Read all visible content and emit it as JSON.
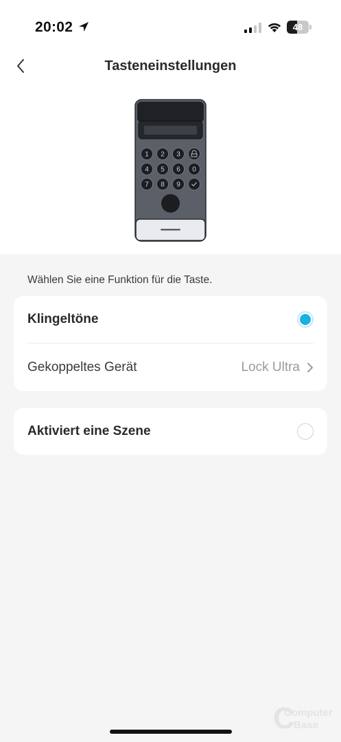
{
  "status_bar": {
    "time": "20:02",
    "battery_level": "48",
    "battery_fraction": 0.48
  },
  "nav": {
    "title": "Tasteneinstellungen",
    "back_icon": "chevron-left-icon"
  },
  "device": {
    "keypad_keys": [
      "1",
      "2",
      "3",
      "lock",
      "4",
      "5",
      "6",
      "0",
      "7",
      "8",
      "9",
      "check"
    ]
  },
  "content": {
    "hint": "Wählen Sie eine Funktion für die Taste.",
    "options": [
      {
        "label": "Klingeltöne",
        "selected": true
      },
      {
        "label": "Aktiviert eine Szene",
        "selected": false
      }
    ],
    "linked_device": {
      "label": "Gekoppeltes Gerät",
      "value": "Lock Ultra"
    }
  },
  "watermark": {
    "line1": "Computer",
    "line2": "Base"
  },
  "colors": {
    "accent": "#1ab0e2",
    "background": "#f5f5f5",
    "card": "#ffffff",
    "text_primary": "#2a2a2e",
    "text_secondary": "#9a9a9e"
  }
}
